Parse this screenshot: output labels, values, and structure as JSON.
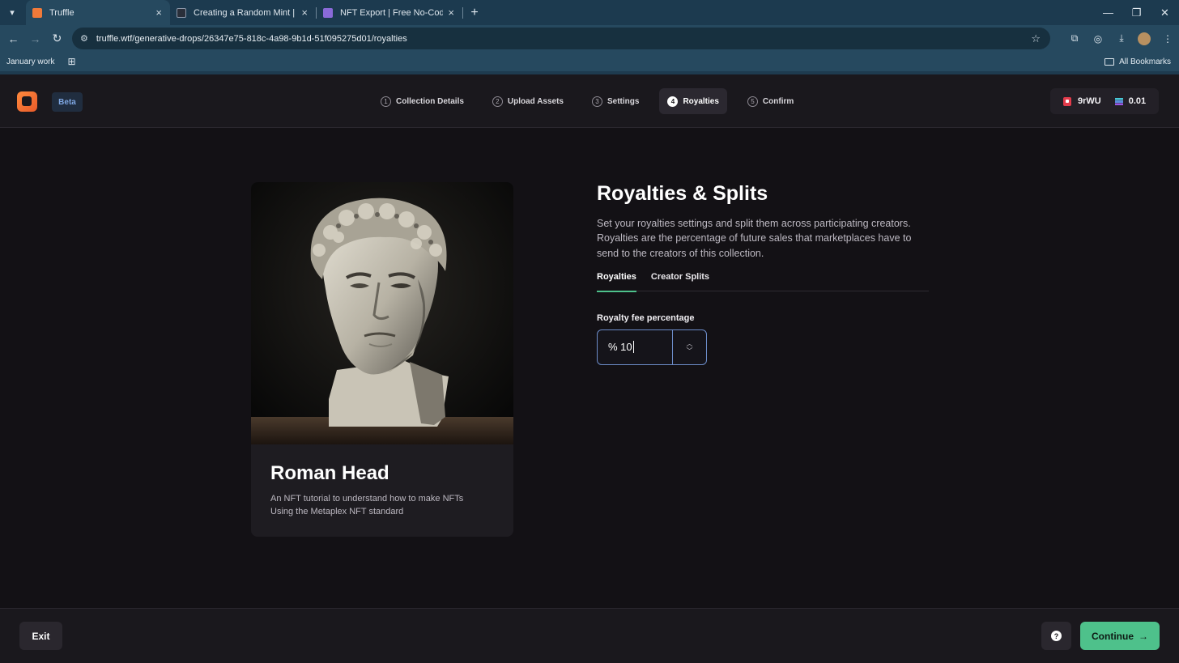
{
  "browser": {
    "tabs": [
      {
        "title": "Truffle",
        "active": true,
        "favicon_color": "#f07a3a"
      },
      {
        "title": "Creating a Random Mint | Truffl",
        "active": false,
        "favicon_color": "#2a2f3a"
      },
      {
        "title": "NFT Export | Free No-Code NFT",
        "active": false,
        "favicon_color": "#8a6ad8"
      }
    ],
    "new_tab": "+",
    "url": "truffle.wtf/generative-drops/26347e75-818c-4a98-9b1d-51f095275d01/royalties",
    "bookmarks": {
      "items": [
        {
          "label": "January work"
        }
      ],
      "all_bookmarks": "All Bookmarks"
    }
  },
  "header": {
    "badge": "Beta",
    "steps": [
      {
        "num": "1",
        "label": "Collection Details",
        "active": false
      },
      {
        "num": "2",
        "label": "Upload Assets",
        "active": false
      },
      {
        "num": "3",
        "label": "Settings",
        "active": false
      },
      {
        "num": "4",
        "label": "Royalties",
        "active": true
      },
      {
        "num": "5",
        "label": "Confirm",
        "active": false
      }
    ],
    "wallet": {
      "address": "9rWU",
      "balance": "0.01"
    }
  },
  "card": {
    "title": "Roman Head",
    "description_lines": [
      "An NFT tutorial to understand how to make NFTs",
      "Using the Metaplex NFT standard"
    ]
  },
  "panel": {
    "title": "Royalties & Splits",
    "description": "Set your royalties settings and split them across participating creators. Royalties are the percentage of future sales that marketplaces have to send to the creators of this collection.",
    "tabs": [
      {
        "label": "Royalties",
        "active": true
      },
      {
        "label": "Creator Splits",
        "active": false
      }
    ],
    "field_label": "Royalty fee percentage",
    "field_value": "% 10"
  },
  "footer": {
    "exit": "Exit",
    "help": "?",
    "continue": "Continue",
    "continue_arrow": "→"
  },
  "colors": {
    "accent": "#4ec18b",
    "background": "#131115",
    "focus_border": "#6c8cc8",
    "beta": "#7ea6e2"
  }
}
